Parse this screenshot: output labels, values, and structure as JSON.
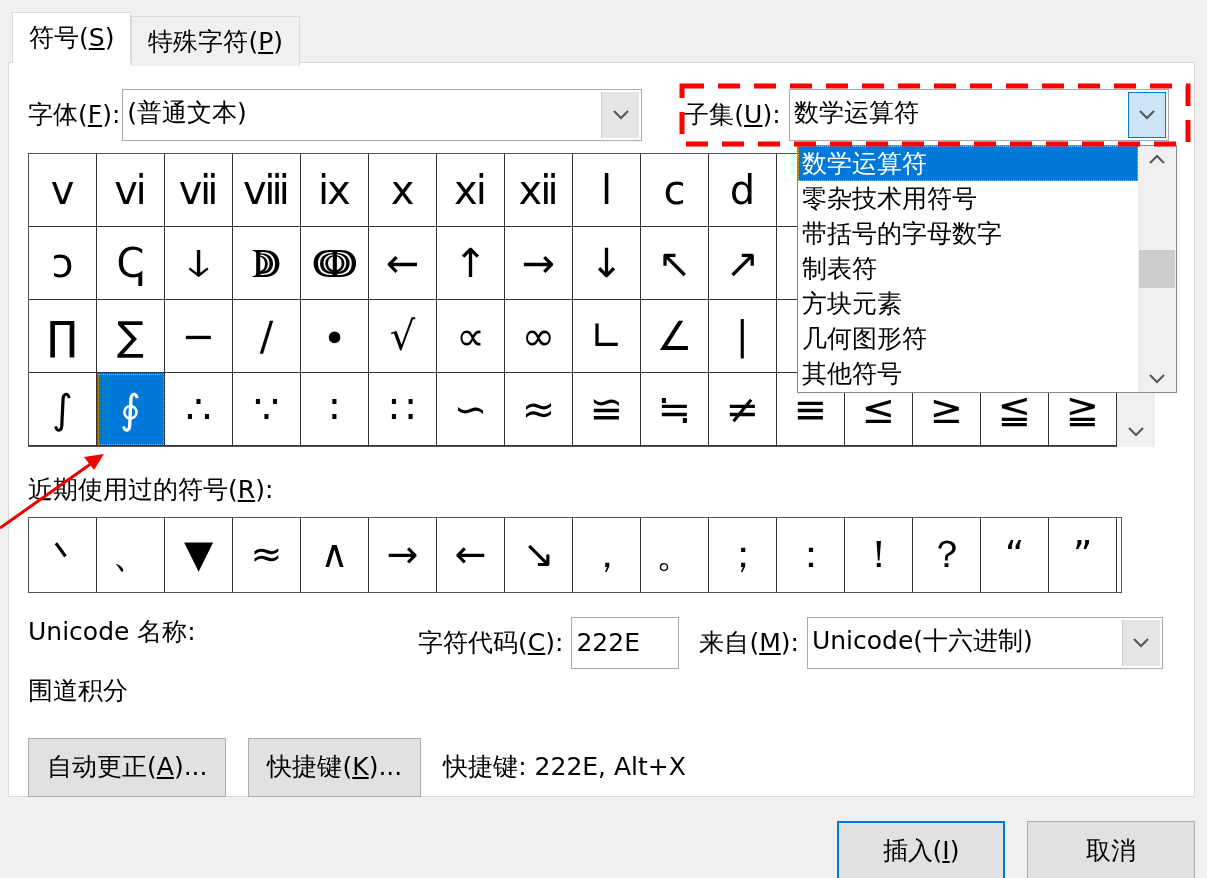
{
  "tabs": [
    {
      "label": [
        "符号(",
        "S",
        ")"
      ],
      "selected": true
    },
    {
      "label": [
        "特殊字符(",
        "P",
        ")"
      ],
      "selected": false
    }
  ],
  "font": {
    "label": [
      "字体(",
      "F",
      "):"
    ],
    "value": "(普通文本)"
  },
  "subset": {
    "label": [
      "子集(",
      "U",
      "):"
    ],
    "value": "数学运算符",
    "expanded": true,
    "options": [
      {
        "label": "数学运算符",
        "selected": true
      },
      {
        "label": "零杂技术用符号",
        "selected": false
      },
      {
        "label": "带括号的字母数字",
        "selected": false
      },
      {
        "label": "制表符",
        "selected": false
      },
      {
        "label": "方块元素",
        "selected": false
      },
      {
        "label": "几何图形符",
        "selected": false
      },
      {
        "label": "其他符号",
        "selected": false
      }
    ]
  },
  "symbols": [
    [
      {
        "char": "ⅴ",
        "selected": false
      },
      {
        "char": "ⅵ",
        "selected": false
      },
      {
        "char": "ⅶ",
        "selected": false
      },
      {
        "char": "ⅷ",
        "selected": false
      },
      {
        "char": "ⅸ",
        "selected": false
      },
      {
        "char": "ⅹ",
        "selected": false
      },
      {
        "char": "ⅺ",
        "selected": false
      },
      {
        "char": "ⅻ",
        "selected": false
      },
      {
        "char": "ⅼ",
        "selected": false
      },
      {
        "char": "ⅽ",
        "selected": false
      },
      {
        "char": "ⅾ",
        "selected": false
      }
    ],
    [
      {
        "char": "ↄ",
        "selected": false
      },
      {
        "char": "ↅ",
        "selected": false
      },
      {
        "char": "ↆ",
        "selected": false
      },
      {
        "char": "ↇ",
        "selected": false
      },
      {
        "char": "ↈ",
        "selected": false
      },
      {
        "char": "←",
        "selected": false
      },
      {
        "char": "↑",
        "selected": false
      },
      {
        "char": "→",
        "selected": false
      },
      {
        "char": "↓",
        "selected": false
      },
      {
        "char": "↖",
        "selected": false
      },
      {
        "char": "↗",
        "selected": false
      }
    ],
    [
      {
        "char": "∏",
        "selected": false
      },
      {
        "char": "∑",
        "selected": false
      },
      {
        "char": "−",
        "selected": false
      },
      {
        "char": "∕",
        "selected": false
      },
      {
        "char": "∙",
        "selected": false
      },
      {
        "char": "√",
        "selected": false
      },
      {
        "char": "∝",
        "selected": false
      },
      {
        "char": "∞",
        "selected": false
      },
      {
        "char": "∟",
        "selected": false
      },
      {
        "char": "∠",
        "selected": false
      },
      {
        "char": "∣",
        "selected": false
      }
    ],
    [
      {
        "char": "∫",
        "selected": false
      },
      {
        "char": "∮",
        "selected": true
      },
      {
        "char": "∴",
        "selected": false
      },
      {
        "char": "∵",
        "selected": false
      },
      {
        "char": "∶",
        "selected": false
      },
      {
        "char": "∷",
        "selected": false
      },
      {
        "char": "∽",
        "selected": false
      },
      {
        "char": "≈",
        "selected": false
      },
      {
        "char": "≌",
        "selected": false
      },
      {
        "char": "≒",
        "selected": false
      },
      {
        "char": "≠",
        "selected": false
      },
      {
        "char": "≡",
        "selected": false
      },
      {
        "char": "≤",
        "selected": false
      },
      {
        "char": "≥",
        "selected": false
      },
      {
        "char": "≦",
        "selected": false
      },
      {
        "char": "≧",
        "selected": false
      }
    ]
  ],
  "recent": {
    "label": [
      "近期使用过的符号(",
      "R",
      "):"
    ],
    "symbols": [
      "丶",
      "、",
      "▼",
      "≈",
      "∧",
      "→",
      "←",
      "↘",
      "，",
      "。",
      "；",
      "：",
      "！",
      "？",
      "“",
      "”"
    ]
  },
  "unicode_name": {
    "label": "Unicode 名称:",
    "value": "围道积分"
  },
  "char_code": {
    "label": [
      "字符代码(",
      "C",
      "):"
    ],
    "value": "222E"
  },
  "from": {
    "label": [
      "来自(",
      "M",
      "):"
    ],
    "value": "Unicode(十六进制)"
  },
  "action_buttons": [
    {
      "label": [
        "自动更正(",
        "A",
        ")..."
      ]
    },
    {
      "label": [
        "快捷键(",
        "K",
        ")..."
      ]
    }
  ],
  "shortcut_text": "快捷键: 222E, Alt+X",
  "footer_buttons": [
    {
      "label": [
        "插入(",
        "I",
        ")"
      ],
      "default": true
    },
    {
      "label": [
        "取消"
      ],
      "default": false
    }
  ]
}
